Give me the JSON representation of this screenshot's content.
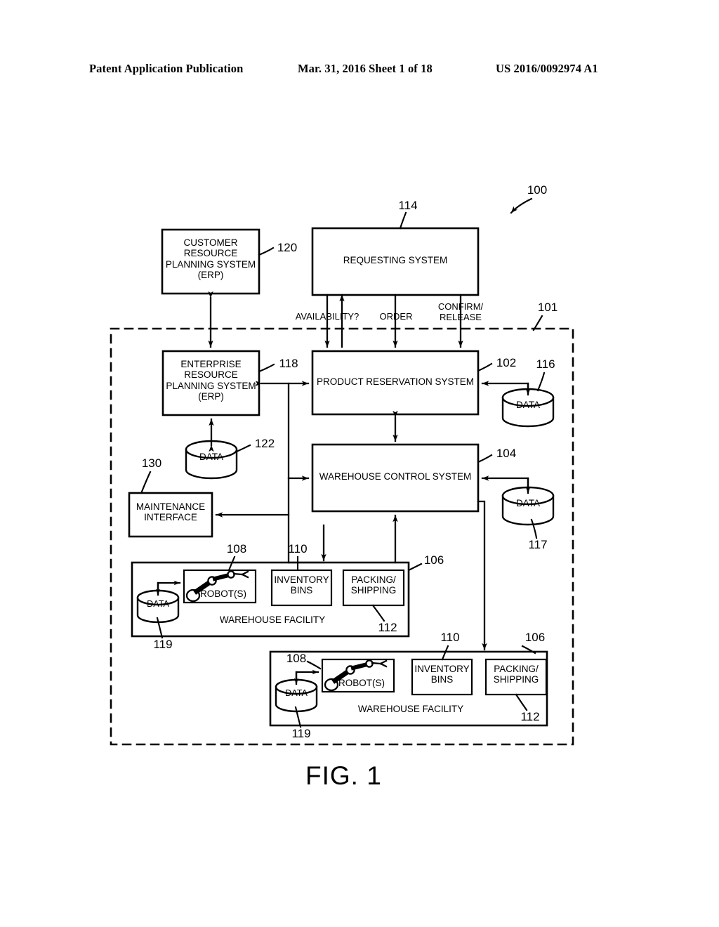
{
  "header": {
    "publication": "Patent Application Publication",
    "date_sheet": "Mar. 31, 2016  Sheet 1 of 18",
    "patent_number": "US 2016/0092974 A1"
  },
  "figure": {
    "label": "FIG. 1",
    "system_ref": "100",
    "boundary_ref": "101"
  },
  "boxes": {
    "customer_erp": {
      "text": "CUSTOMER\nRESOURCE\nPLANNING SYSTEM\n(ERP)",
      "ref": "120"
    },
    "requesting_system": {
      "text": "REQUESTING SYSTEM",
      "ref": "114"
    },
    "enterprise_erp": {
      "text": "ENTERPRISE\nRESOURCE\nPLANNING SYSTEM\n(ERP)",
      "ref": "118"
    },
    "product_reservation": {
      "text": "PRODUCT RESERVATION SYSTEM",
      "ref": "102"
    },
    "warehouse_control": {
      "text": "WAREHOUSE CONTROL SYSTEM",
      "ref": "104"
    },
    "maintenance_interface": {
      "text": "MAINTENANCE\nINTERFACE",
      "ref": "130"
    }
  },
  "datastores": {
    "prs_data": {
      "text": "DATA",
      "ref": "116"
    },
    "wcs_data": {
      "text": "DATA",
      "ref": "117"
    },
    "erp_data": {
      "text": "DATA",
      "ref": "122"
    },
    "wh1_data": {
      "text": "DATA",
      "ref": "119"
    },
    "wh2_data": {
      "text": "DATA",
      "ref": "119"
    }
  },
  "flow_labels": {
    "availability": "AVAILABILITY?",
    "order": "ORDER",
    "confirm_release": "CONFIRM/\nRELEASE"
  },
  "warehouses": [
    {
      "title": "WAREHOUSE FACILITY",
      "ref": "106",
      "robots": {
        "text": "ROBOT(S)",
        "ref": "108"
      },
      "inventory_bins": {
        "text": "INVENTORY\nBINS",
        "ref": "110"
      },
      "packing_shipping": {
        "text": "PACKING/\nSHIPPING",
        "ref": "112"
      },
      "data": {
        "text": "DATA",
        "ref": "119"
      }
    },
    {
      "title": "WAREHOUSE FACILITY",
      "ref": "106",
      "robots": {
        "text": "ROBOT(S)",
        "ref": "108"
      },
      "inventory_bins": {
        "text": "INVENTORY\nBINS",
        "ref": "110"
      },
      "packing_shipping": {
        "text": "PACKING/\nSHIPPING",
        "ref": "112"
      },
      "data": {
        "text": "DATA",
        "ref": "119"
      }
    }
  ],
  "colors": {
    "ink": "#000000",
    "paper": "#ffffff"
  }
}
